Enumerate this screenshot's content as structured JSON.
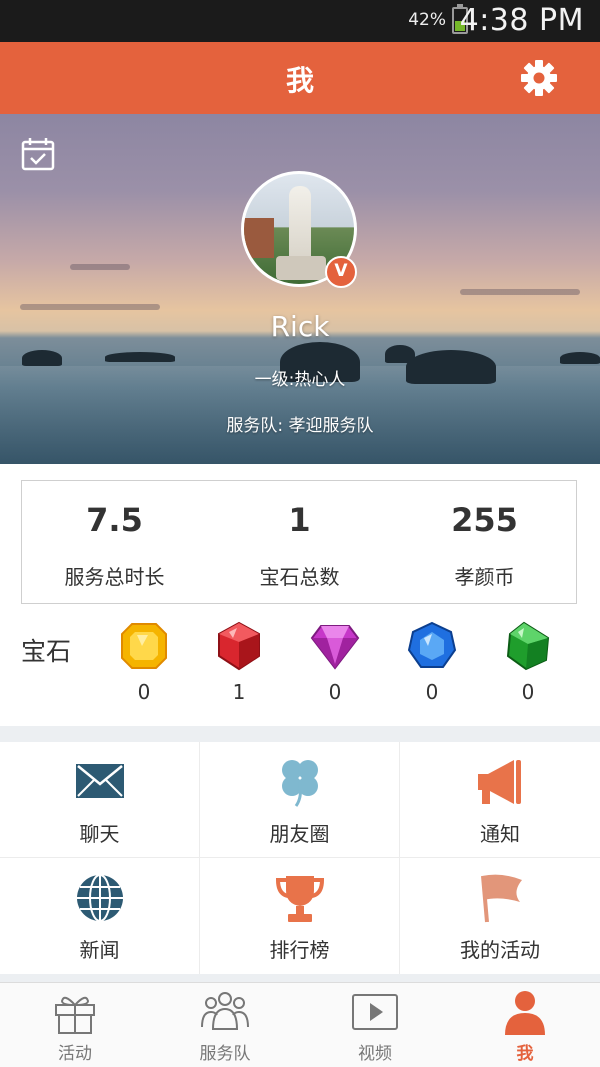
{
  "status_bar": {
    "battery_percent": "42%",
    "battery_level": 0.42,
    "time": "4:38 PM"
  },
  "header": {
    "title": "我"
  },
  "profile": {
    "name": "Rick",
    "level": "一级:热心人",
    "team": "服务队: 孝迎服务队",
    "badge": "V"
  },
  "stats": [
    {
      "value": "7.5",
      "label": "服务总时长"
    },
    {
      "value": "1",
      "label": "宝石总数"
    },
    {
      "value": "255",
      "label": "孝颜币"
    }
  ],
  "gems": {
    "title": "宝石",
    "items": [
      {
        "icon": "yellow-gem-icon",
        "color": "#f5b400",
        "count": "0"
      },
      {
        "icon": "red-gem-icon",
        "color": "#d9262e",
        "count": "1"
      },
      {
        "icon": "purple-diamond-icon",
        "color": "#c637c9",
        "count": "0"
      },
      {
        "icon": "blue-gem-icon",
        "color": "#1f6fe0",
        "count": "0"
      },
      {
        "icon": "green-gem-icon",
        "color": "#1f9e2c",
        "count": "0"
      }
    ]
  },
  "menu": [
    {
      "icon": "envelope-icon",
      "label": "聊天"
    },
    {
      "icon": "clover-icon",
      "label": "朋友圈"
    },
    {
      "icon": "megaphone-icon",
      "label": "通知"
    },
    {
      "icon": "globe-icon",
      "label": "新闻"
    },
    {
      "icon": "trophy-icon",
      "label": "排行榜"
    },
    {
      "icon": "flag-icon",
      "label": "我的活动"
    }
  ],
  "bottom_nav": [
    {
      "icon": "gift-icon",
      "label": "活动",
      "active": false
    },
    {
      "icon": "team-icon",
      "label": "服务队",
      "active": false
    },
    {
      "icon": "video-icon",
      "label": "视频",
      "active": false
    },
    {
      "icon": "person-icon",
      "label": "我",
      "active": true
    }
  ],
  "colors": {
    "accent": "#e4623d",
    "icon_dark": "#2d5a73",
    "icon_light": "#7fb8cf",
    "icon_orange": "#e8734a"
  }
}
